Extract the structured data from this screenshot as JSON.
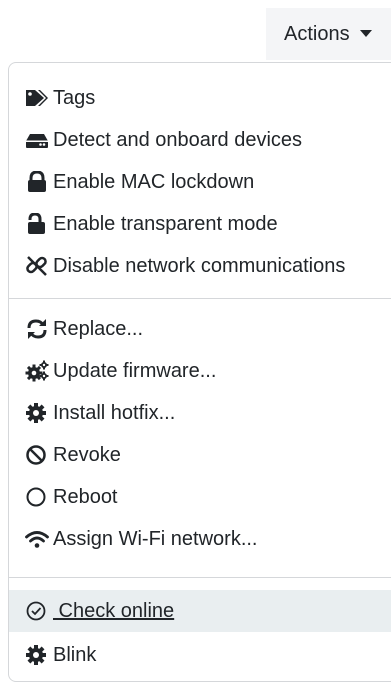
{
  "actions_button": {
    "label": "Actions"
  },
  "menu": {
    "group1": [
      {
        "label": "Tags",
        "icon": "tags-icon"
      },
      {
        "label": "Detect and onboard devices",
        "icon": "hdd-icon"
      },
      {
        "label": "Enable MAC lockdown",
        "icon": "lock-icon"
      },
      {
        "label": "Enable transparent mode",
        "icon": "unlock-icon"
      },
      {
        "label": "Disable network communications",
        "icon": "unlink-icon"
      }
    ],
    "group2": [
      {
        "label": "Replace...",
        "icon": "sync-icon"
      },
      {
        "label": "Update firmware...",
        "icon": "cogs-icon"
      },
      {
        "label": "Install hotfix...",
        "icon": "cog-icon"
      },
      {
        "label": "Revoke",
        "icon": "ban-icon"
      },
      {
        "label": "Reboot",
        "icon": "circle-icon"
      },
      {
        "label": "Assign Wi-Fi network...",
        "icon": "wifi-icon"
      }
    ],
    "group3": [
      {
        "label": " Check online",
        "icon": "check-circle-icon"
      },
      {
        "label": "Blink",
        "icon": "cog-icon"
      }
    ]
  }
}
